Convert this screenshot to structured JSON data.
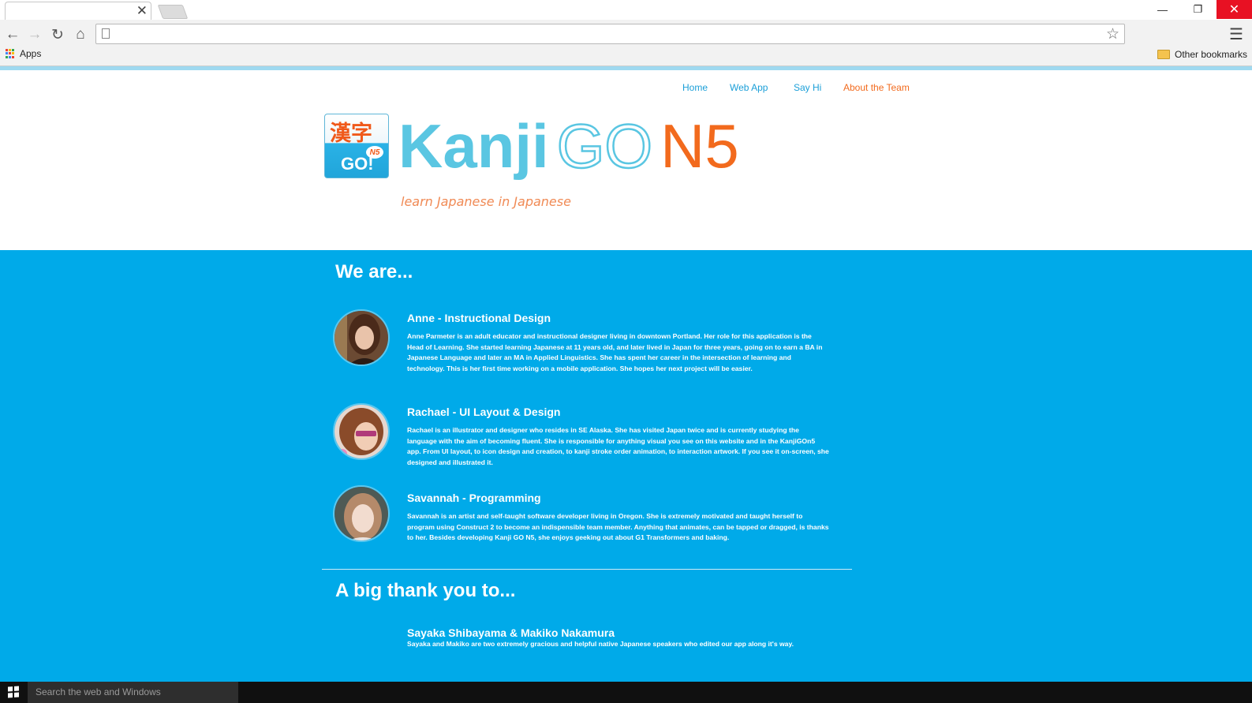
{
  "browser": {
    "tab_close_glyph": "✕",
    "window_buttons": {
      "minimize": "—",
      "maximize": "❐",
      "close": "✕"
    },
    "bookmarks": {
      "apps_label": "Apps",
      "other_label": "Other bookmarks"
    }
  },
  "nav": {
    "items": [
      {
        "label": "Home",
        "color": "#1b9fd8"
      },
      {
        "label": "Web App",
        "color": "#1b9fd8"
      },
      {
        "label": "Say Hi",
        "color": "#1b9fd8"
      },
      {
        "label": "About the Team",
        "color": "#f26a1d"
      }
    ]
  },
  "logo": {
    "kanji": "漢字",
    "go": "GO!",
    "badge": "N5"
  },
  "brand": {
    "word1": "Kanji",
    "word2": "GO",
    "word3": "N5",
    "tagline": "learn Japanese in Japanese"
  },
  "colors": {
    "brand_blue": "#5ac6e2",
    "brand_orange": "#f26a1d",
    "section_bg": "#00aae9"
  },
  "team": {
    "heading": "We are...",
    "members": [
      {
        "name": "Anne - Instructional Design",
        "bio": "Anne Parmeter is an adult educator and instructional designer living in downtown Portland. Her role for this application is the Head of Learning. She started learning Japanese at 11 years old, and later lived in Japan for three years, going on to earn a BA in Japanese Language and later an MA in Applied Linguistics. She has spent her career in the intersection of learning and technology. This is her first time working on a mobile application. She hopes her next project will be easier."
      },
      {
        "name": "Rachael - UI Layout & Design",
        "bio": "Rachael is an illustrator and designer who resides in SE Alaska. She has visited Japan twice and is currently studying the language with the aim of becoming fluent. She is responsible for anything visual you see on this website and in the KanjiGOn5 app. From UI layout, to icon design and creation, to kanji stroke order animation, to interaction artwork. If you see it on-screen, she designed and illustrated it."
      },
      {
        "name": "Savannah - Programming",
        "bio": "Savannah is an artist and self-taught software developer  living in Oregon. She is extremely motivated and taught herself to program using Construct 2 to become an indispensible team member. Anything that animates, can be tapped or dragged, is thanks to her. Besides developing Kanji GO N5, she enjoys geeking out about G1 Transformers and baking."
      }
    ]
  },
  "thanks": {
    "heading": "A big thank you to...",
    "name": "Sayaka Shibayama & Makiko Nakamura",
    "bio": "Sayaka and Makiko are two extremely gracious and helpful native Japanese speakers who edited our app along it's way."
  },
  "taskbar": {
    "search_placeholder": "Search the web and Windows"
  }
}
